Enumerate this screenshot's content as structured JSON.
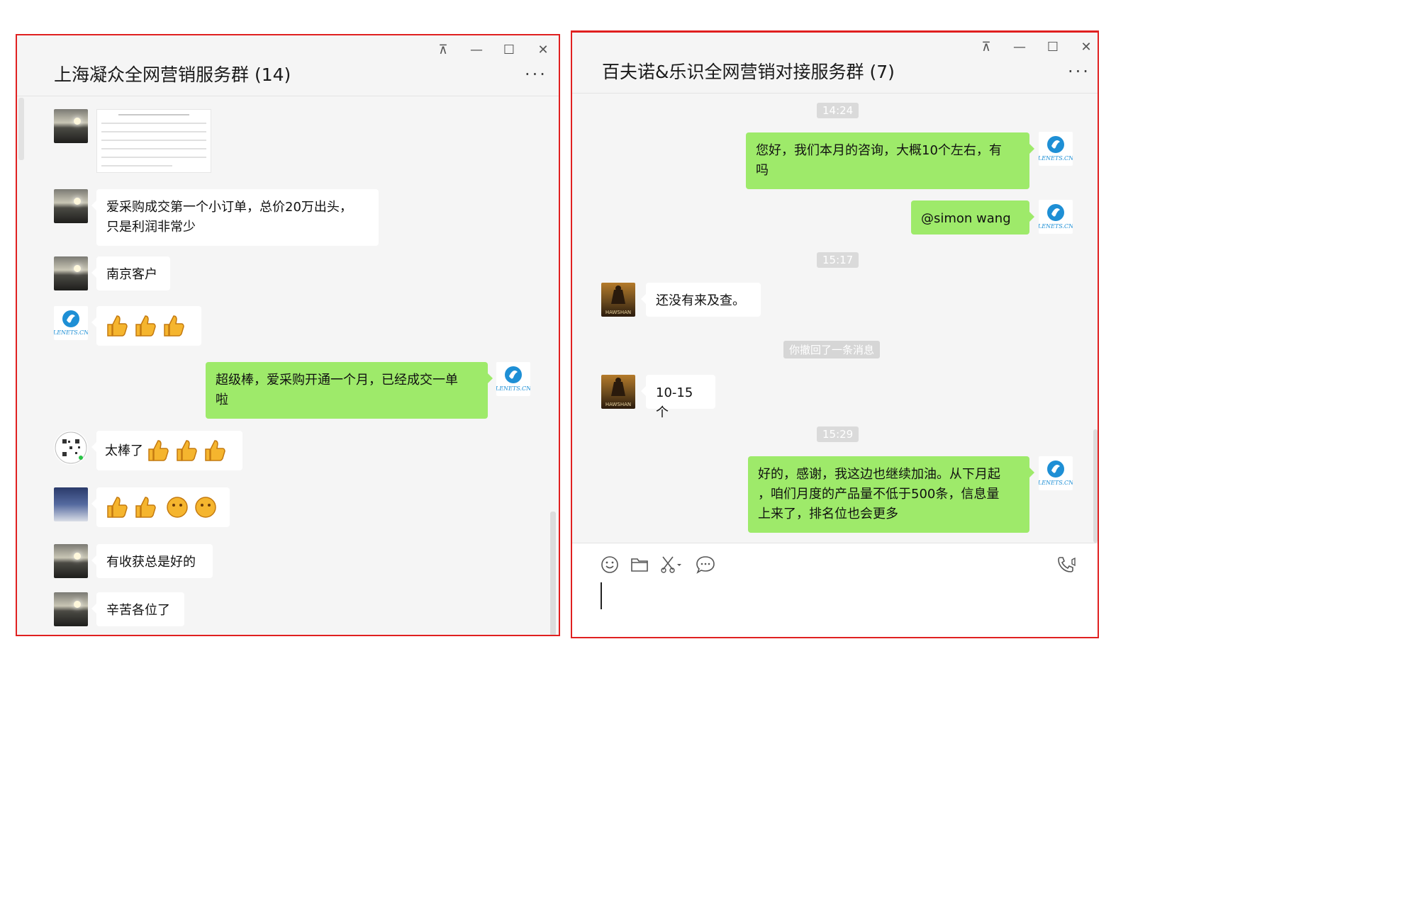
{
  "left_window": {
    "title": "上海凝众全网营销服务群 (14)",
    "controls": {
      "pin": "⊼",
      "minimize": "—",
      "maximize": "☐",
      "close": "✕",
      "more": "..."
    },
    "messages": [
      {
        "type": "image"
      },
      {
        "text": "爱采购成交第一个小订单，总价20万出头，\n只是利润非常少"
      },
      {
        "text": "南京客户"
      },
      {
        "type": "emoji"
      },
      {
        "text": "超级棒，爱采购开通一个月，已经成交一单\n啦"
      },
      {
        "text": "太棒了"
      },
      {
        "type": "emoji"
      },
      {
        "text": "有收获总是好的"
      },
      {
        "text": "辛苦各位了"
      }
    ],
    "logo_text": "LENETS.CN"
  },
  "right_window": {
    "title": "百夫诺&乐识全网营销对接服务群 (7)",
    "controls": {
      "pin": "⊼",
      "minimize": "—",
      "maximize": "☐",
      "close": "✕",
      "more": "..."
    },
    "times": [
      "14:24",
      "15:17",
      "15:29"
    ],
    "recall_notice": "你撤回了一条消息",
    "messages": [
      {
        "text": "您好，我们本月的咨询，大概10个左右，有\n吗"
      },
      {
        "text": "@simon wang"
      },
      {
        "text": "还没有来及查。"
      },
      {
        "text": "10-15个"
      },
      {
        "text": "好的，感谢，我这边也继续加油。从下月起\n，咱们月度的产品量不低于500条，信息量\n上来了，排名位也会更多"
      }
    ],
    "avatar_caption": "HAWSHAN",
    "logo_text": "LENETS.CN"
  },
  "colors": {
    "frame": "#e02020",
    "bubble_green": "#9eea6a",
    "chat_bg": "#f5f5f5"
  }
}
